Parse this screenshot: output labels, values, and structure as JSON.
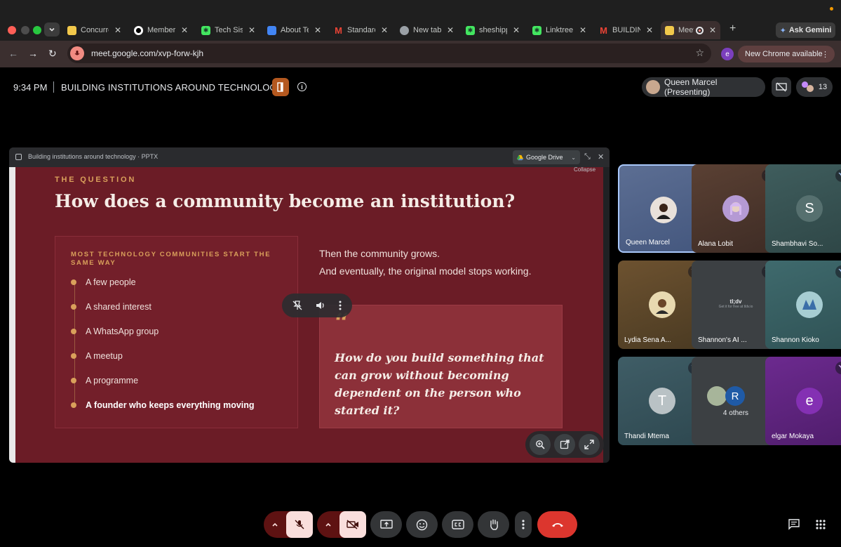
{
  "browser": {
    "tabs": [
      {
        "title": "Concurre",
        "favicon": "mail-icon"
      },
      {
        "title": "Members",
        "favicon": "github-icon"
      },
      {
        "title": "Tech Sist",
        "favicon": "linktree-icon"
      },
      {
        "title": "About Te",
        "favicon": "docs-icon"
      },
      {
        "title": "Standard",
        "favicon": "gmail-icon"
      },
      {
        "title": "New tab",
        "favicon": "chrome-icon"
      },
      {
        "title": "sheshipp",
        "favicon": "linktree-icon"
      },
      {
        "title": "Linktree",
        "favicon": "linktree-icon"
      },
      {
        "title": "BUILDIN",
        "favicon": "gmail-icon"
      },
      {
        "title": "Meet",
        "favicon": "meet-icon"
      }
    ],
    "new_tab_symbol": "+",
    "ask_gemini": "Ask Gemini",
    "url": "meet.google.com/xvp-forw-kjh",
    "profile_initial": "e",
    "new_chrome": "New Chrome available"
  },
  "meet": {
    "time": "9:34 PM",
    "title": "BUILDING INSTITUTIONS AROUND TECHNOLOGY",
    "info_symbol": "i",
    "presenter": "Queen Marcel (Presenting)",
    "participant_count": "13"
  },
  "presentation": {
    "file": "Building institutions around technology · PPTX",
    "drive": "Google Drive",
    "collapse_tip": "Collapse",
    "slide": {
      "eyebrow": "THE QUESTION",
      "headline": "How does a community become an institution?",
      "left_card_title": "MOST TECHNOLOGY COMMUNITIES START THE SAME WAY",
      "items": [
        "A few people",
        "A shared interest",
        "A WhatsApp group",
        "A meetup",
        "A programme",
        "A founder who keeps everything moving"
      ],
      "para1": "Then the community grows.",
      "para2": "And eventually, the original model stops working.",
      "quote_mark": "“",
      "quote": "How do you build something that can grow without becoming dependent on the person who started it?"
    }
  },
  "participants": [
    {
      "name": "Queen Marcel"
    },
    {
      "name": "Alana Lobit"
    },
    {
      "name": "Shambhavi So...",
      "initial": "S"
    },
    {
      "name": "Lydia Sena A..."
    },
    {
      "name": "Shannon's AI ...",
      "logo_line1": "tl;dv",
      "logo_line2": "Get it for free at tldv.io"
    },
    {
      "name": "Shannon Kioko"
    },
    {
      "name": "Thandi Mtema",
      "initial": "T"
    },
    {
      "name": "4 others",
      "initial": "R"
    },
    {
      "name": "elgar Mokaya",
      "initial": "e"
    }
  ],
  "colors": {
    "accent_gold": "#d9a05b",
    "slide_bg": "#6b1c26",
    "hangup": "#dc362e"
  }
}
